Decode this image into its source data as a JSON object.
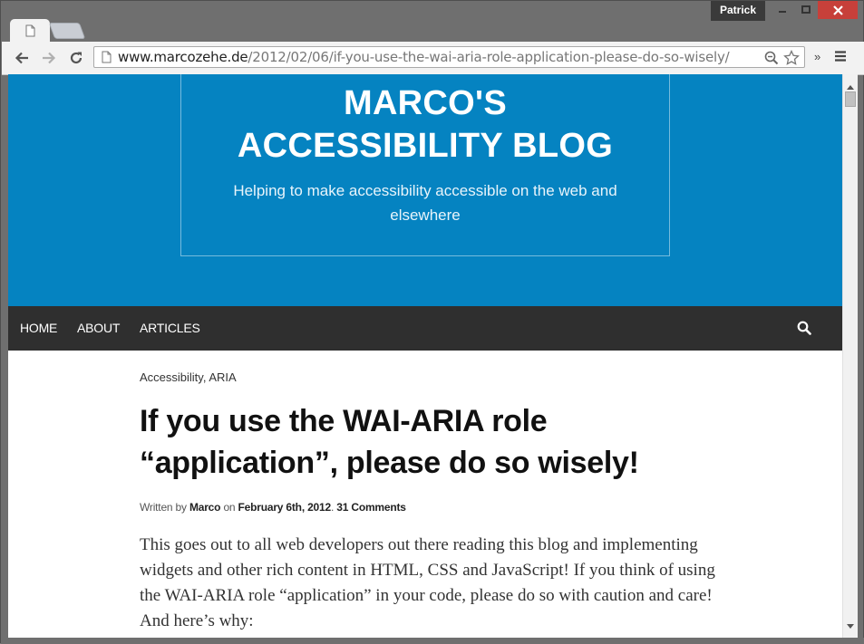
{
  "window": {
    "user": "Patrick"
  },
  "browser": {
    "url_domain": "www.marcozehe.de",
    "url_path": "/2012/02/06/if-you-use-the-wai-aria-role-application-please-do-so-wisely/",
    "extensions_label": "»"
  },
  "site": {
    "title_line1": "MARCO'S",
    "title_line2": "ACCESSIBILITY BLOG",
    "tagline": "Helping to make accessibility accessible on the web and elsewhere"
  },
  "nav": {
    "items": [
      {
        "label": "HOME"
      },
      {
        "label": "ABOUT"
      },
      {
        "label": "ARTICLES"
      }
    ]
  },
  "post": {
    "categories": "Accessibility, ARIA",
    "title": "If you use the WAI-ARIA role “application”, please do so wisely!",
    "meta_written_by": "Written by",
    "meta_author": "Marco",
    "meta_on": "on",
    "meta_date": "February 6th, 2012",
    "meta_sep": ".",
    "meta_comments": "31 Comments",
    "body": "This goes out to all web developers out there reading this blog and implementing widgets and other rich content in HTML, CSS and JavaScript! If you think of using the WAI-ARIA role “application” in your code, please do so with caution and care! And here’s why:"
  },
  "colors": {
    "header_bg": "#0583c1",
    "nav_bg": "#2f2f2f",
    "close_btn": "#c7403a"
  }
}
